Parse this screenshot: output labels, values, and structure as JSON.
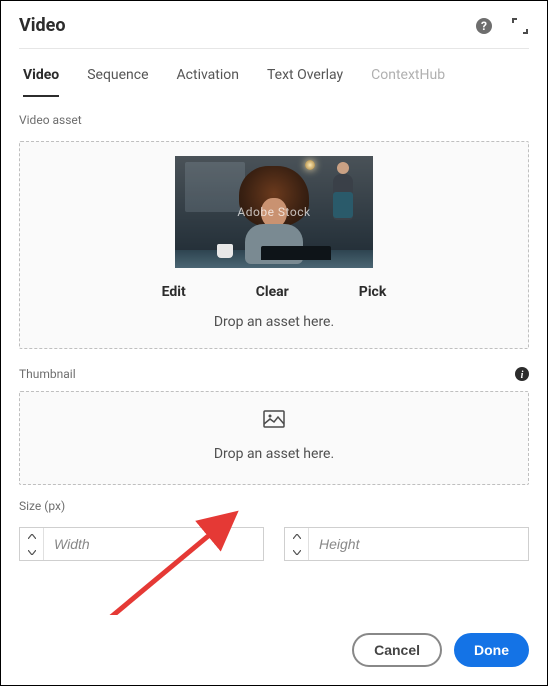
{
  "header": {
    "title": "Video"
  },
  "tabs": [
    {
      "label": "Video",
      "state": "active"
    },
    {
      "label": "Sequence",
      "state": "normal"
    },
    {
      "label": "Activation",
      "state": "normal"
    },
    {
      "label": "Text Overlay",
      "state": "normal"
    },
    {
      "label": "ContextHub",
      "state": "disabled"
    }
  ],
  "video_asset": {
    "section_label": "Video asset",
    "watermark": "Adobe Stock",
    "actions": {
      "edit": "Edit",
      "clear": "Clear",
      "pick": "Pick"
    },
    "drop_text": "Drop an asset here."
  },
  "thumbnail": {
    "section_label": "Thumbnail",
    "drop_text": "Drop an asset here."
  },
  "size": {
    "section_label": "Size (px)",
    "width_placeholder": "Width",
    "height_placeholder": "Height",
    "width_value": "",
    "height_value": ""
  },
  "footer": {
    "cancel": "Cancel",
    "done": "Done"
  }
}
